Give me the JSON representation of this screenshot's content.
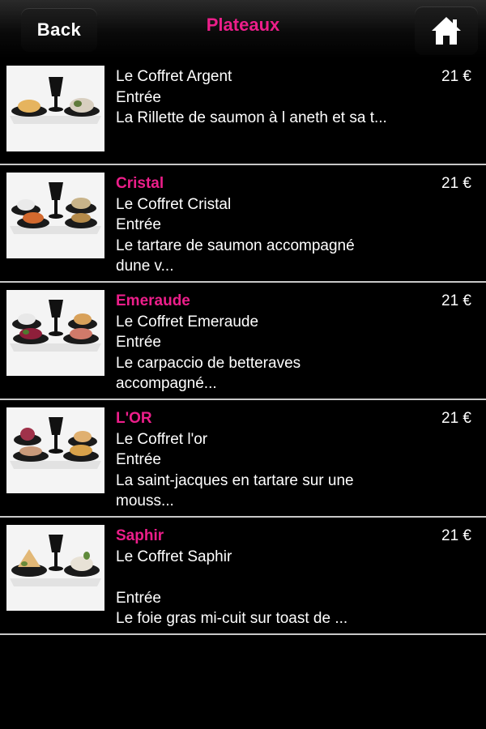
{
  "header": {
    "back_label": "Back",
    "title": "Plateaux",
    "home_icon": "home-icon"
  },
  "colors": {
    "accent": "#ec1e8a",
    "background": "#000000",
    "divider": "#c8c8c8"
  },
  "items": [
    {
      "name": "",
      "coffret": "Le Coffret Argent",
      "course": "Entrée",
      "description": "La Rillette de saumon à l aneth et sa t...",
      "price": "21 €"
    },
    {
      "name": "Cristal",
      "coffret": "Le Coffret Cristal",
      "course": "Entrée",
      "description": "Le tartare de saumon accompagné dune v...",
      "price": "21 €"
    },
    {
      "name": "Emeraude",
      "coffret": "Le Coffret Emeraude",
      "course": "Entrée",
      "description": "Le carpaccio de betteraves accompagné...",
      "price": "21 €"
    },
    {
      "name": "L'OR",
      "coffret": "Le Coffret l'or",
      "course": "Entrée",
      "description": "La saint-jacques en tartare sur une mouss...",
      "price": "21 €"
    },
    {
      "name": "Saphir",
      "coffret": "Le Coffret Saphir",
      "course": "Entrée",
      "description": "Le foie gras mi-cuit sur toast de ...",
      "price": "21 €"
    }
  ]
}
